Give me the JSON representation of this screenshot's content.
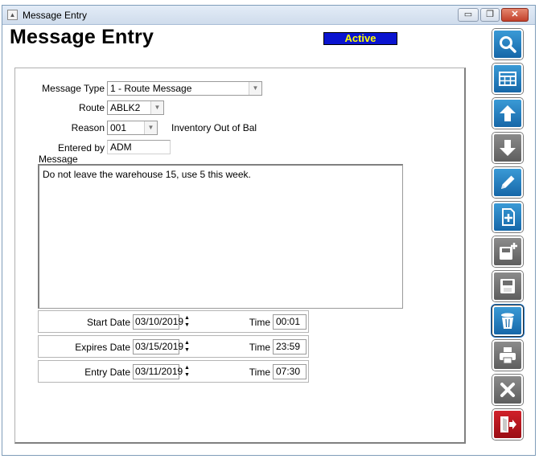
{
  "window": {
    "title": "Message Entry",
    "minimize_glyph": "▭",
    "maximize_glyph": "❐",
    "close_glyph": "✕"
  },
  "page": {
    "title": "Message Entry",
    "status": "Active",
    "status_color": "#0a14d0",
    "status_text_color": "#ffff00"
  },
  "form": {
    "message_type": {
      "label": "Message Type",
      "value": "1 - Route Message"
    },
    "route": {
      "label": "Route",
      "value": "ABLK2"
    },
    "reason": {
      "label": "Reason",
      "value": "001",
      "description": "Inventory Out of Bal"
    },
    "entered_by": {
      "label": "Entered by",
      "value": "ADM"
    },
    "message": {
      "label": "Message",
      "value": "Do not leave the warehouse 15, use 5 this week."
    }
  },
  "dates": {
    "start": {
      "label": "Start Date",
      "date": "03/10/2019",
      "time_label": "Time",
      "time": "00:01"
    },
    "expires": {
      "label": "Expires Date",
      "date": "03/15/2019",
      "time_label": "Time",
      "time": "23:59"
    },
    "entry": {
      "label": "Entry Date",
      "date": "03/11/2019",
      "time_label": "Time",
      "time": "07:30"
    }
  },
  "toolbar": {
    "buttons": [
      {
        "icon": "search-icon",
        "color": "blue"
      },
      {
        "icon": "grid-icon",
        "color": "blue"
      },
      {
        "icon": "arrow-up-icon",
        "color": "blue"
      },
      {
        "icon": "arrow-down-icon",
        "color": "gray"
      },
      {
        "icon": "pencil-icon",
        "color": "blue"
      },
      {
        "icon": "new-document-icon",
        "color": "blue"
      },
      {
        "icon": "save-new-icon",
        "color": "gray"
      },
      {
        "icon": "save-icon",
        "color": "gray"
      },
      {
        "icon": "trash-icon",
        "color": "blue"
      },
      {
        "icon": "print-icon",
        "color": "gray"
      },
      {
        "icon": "cancel-icon",
        "color": "gray"
      },
      {
        "icon": "exit-icon",
        "color": "red"
      }
    ]
  }
}
